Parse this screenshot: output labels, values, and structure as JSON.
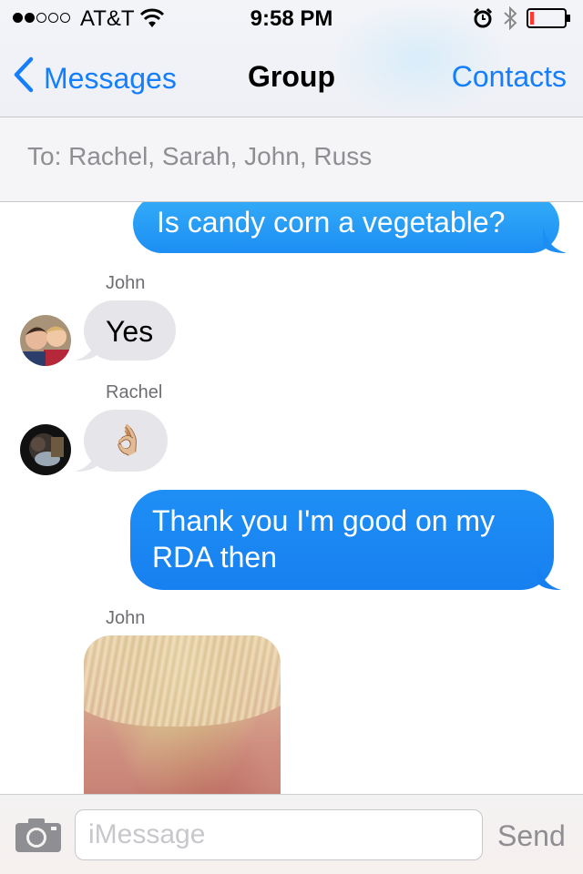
{
  "status_bar": {
    "carrier": "AT&T",
    "time": "9:58 PM",
    "signal_bars": 2,
    "signal_total": 5,
    "battery_level": 0.12
  },
  "nav": {
    "back_label": "Messages",
    "title": "Group",
    "contacts_label": "Contacts"
  },
  "to_field": {
    "text": "To: Rachel, Sarah, John, Russ"
  },
  "messages": [
    {
      "direction": "outgoing",
      "text": "Is candy corn a vegetable?"
    },
    {
      "direction": "incoming",
      "sender": "John",
      "text": "Yes"
    },
    {
      "direction": "incoming",
      "sender": "Rachel",
      "text": "👌🏼"
    },
    {
      "direction": "outgoing",
      "text": "Thank you I'm good on my RDA then"
    },
    {
      "direction": "incoming",
      "sender": "John",
      "type": "photo"
    }
  ],
  "input": {
    "placeholder": "iMessage",
    "value": "",
    "send_label": "Send"
  },
  "colors": {
    "ios_blue": "#147efb",
    "incoming_bubble": "#e5e5ea",
    "battery_low": "#ff3b30"
  },
  "icons": [
    "chevron-left-icon",
    "wifi-icon",
    "alarm-icon",
    "bluetooth-icon",
    "battery-icon",
    "camera-icon"
  ]
}
